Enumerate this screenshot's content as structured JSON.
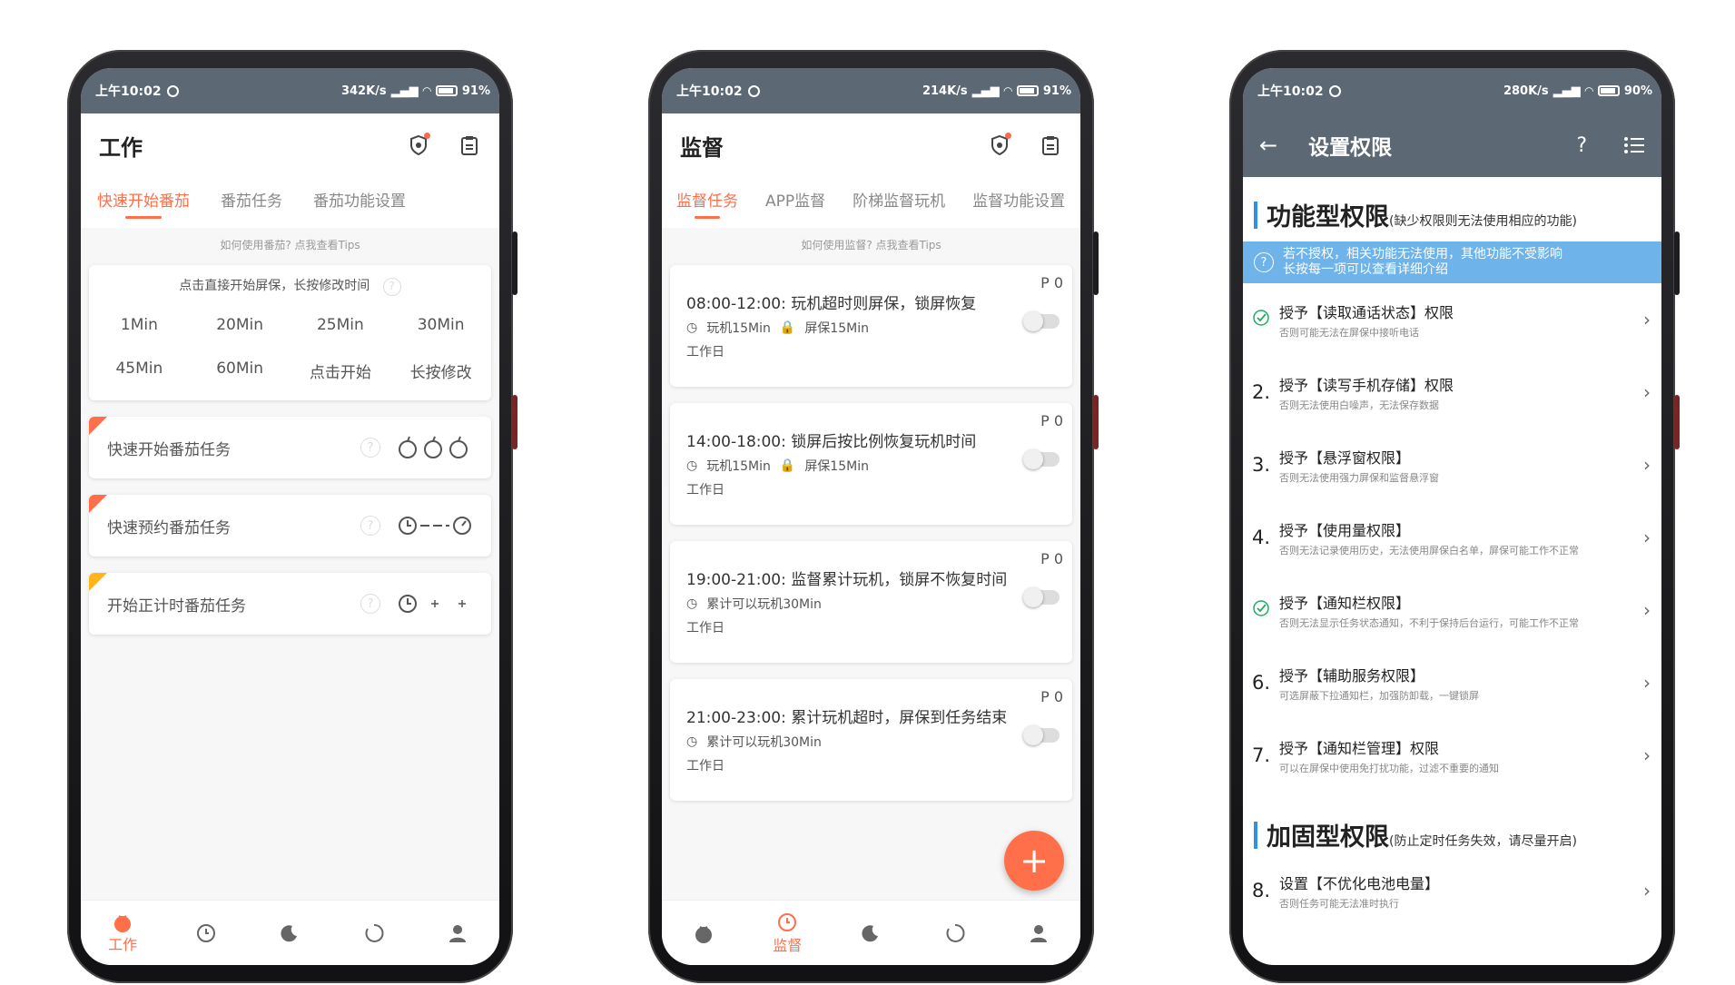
{
  "phones": [
    {
      "status": {
        "time": "上午10:02",
        "speed": "342K/s",
        "battery": "91%"
      },
      "title": "工作",
      "tabs": [
        "快速开始番茄",
        "番茄任务",
        "番茄功能设置"
      ],
      "tip": "如何使用番茄? 点我查看Tips",
      "quickstart": {
        "header": "点击直接开始屏保，长按修改时间",
        "cells": [
          "1Min",
          "20Min",
          "25Min",
          "30Min",
          "45Min",
          "60Min",
          "点击开始",
          "长按修改"
        ]
      },
      "tasks": [
        {
          "label": "快速开始番茄任务"
        },
        {
          "label": "快速预约番茄任务"
        },
        {
          "label": "开始正计时番茄任务"
        }
      ],
      "nav_active_label": "工作",
      "colors": {
        "accent": "#ff6f4a",
        "statusbar": "#5c6873"
      }
    },
    {
      "status": {
        "time": "上午10:02",
        "speed": "214K/s",
        "battery": "91%"
      },
      "title": "监督",
      "tabs": [
        "监督任务",
        "APP监督",
        "阶梯监督玩机",
        "监督功能设置"
      ],
      "tip": "如何使用监督? 点我查看Tips",
      "cards": [
        {
          "prio": "P 0",
          "title": "08:00-12:00: 玩机超时则屏保，锁屏恢复",
          "meta1": "玩机15Min",
          "meta2": "屏保15Min",
          "day": "工作日"
        },
        {
          "prio": "P 0",
          "title": "14:00-18:00: 锁屏后按比例恢复玩机时间",
          "meta1": "玩机15Min",
          "meta2": "屏保15Min",
          "day": "工作日"
        },
        {
          "prio": "P 0",
          "title": "19:00-21:00: 监督累计玩机，锁屏不恢复时间",
          "meta1": "累计可以玩机30Min",
          "meta2": "",
          "day": "工作日"
        },
        {
          "prio": "P 0",
          "title": "21:00-23:00: 累计玩机超时，屏保到任务结束",
          "meta1": "累计可以玩机30Min",
          "meta2": "",
          "day": "工作日"
        }
      ],
      "fab": "+",
      "nav_active_label": "监督"
    },
    {
      "status": {
        "time": "上午10:02",
        "speed": "280K/s",
        "battery": "90%"
      },
      "title": "设置权限",
      "back": "←",
      "help": "?",
      "section1": {
        "title": "功能型权限",
        "subtitle": "(缺少权限则无法使用相应的功能)"
      },
      "banner": {
        "line1": "若不授权，相关功能无法使用，其他功能不受影响",
        "line2": "长按每一项可以查看详细介绍"
      },
      "items": [
        {
          "num": "",
          "checked": true,
          "name": "授予【读取通话状态】权限",
          "desc": "否则可能无法在屏保中接听电话"
        },
        {
          "num": "2.",
          "checked": false,
          "name": "授予【读写手机存储】权限",
          "desc": "否则无法使用白噪声，无法保存数据"
        },
        {
          "num": "3.",
          "checked": false,
          "name": "授予【悬浮窗权限】",
          "desc": "否则无法使用强力屏保和监督悬浮窗"
        },
        {
          "num": "4.",
          "checked": false,
          "name": "授予【使用量权限】",
          "desc": "否则无法记录使用历史，无法使用屏保白名单，屏保可能工作不正常"
        },
        {
          "num": "",
          "checked": true,
          "name": "授予【通知栏权限】",
          "desc": "否则无法显示任务状态通知，不利于保持后台运行，可能工作不正常"
        },
        {
          "num": "6.",
          "checked": false,
          "name": "授予【辅助服务权限】",
          "desc": "可选屏蔽下拉通知栏，加强防卸载，一键锁屏"
        },
        {
          "num": "7.",
          "checked": false,
          "name": "授予【通知栏管理】权限",
          "desc": "可以在屏保中使用免打扰功能，过滤不重要的通知"
        }
      ],
      "section2": {
        "title": "加固型权限",
        "subtitle": "(防止定时任务失效，请尽量开启)"
      },
      "items2": [
        {
          "num": "8.",
          "name": "设置【不优化电池电量】",
          "desc": "否则任务可能无法准时执行"
        }
      ],
      "arrow": "›",
      "check_glyph": "✓"
    }
  ]
}
